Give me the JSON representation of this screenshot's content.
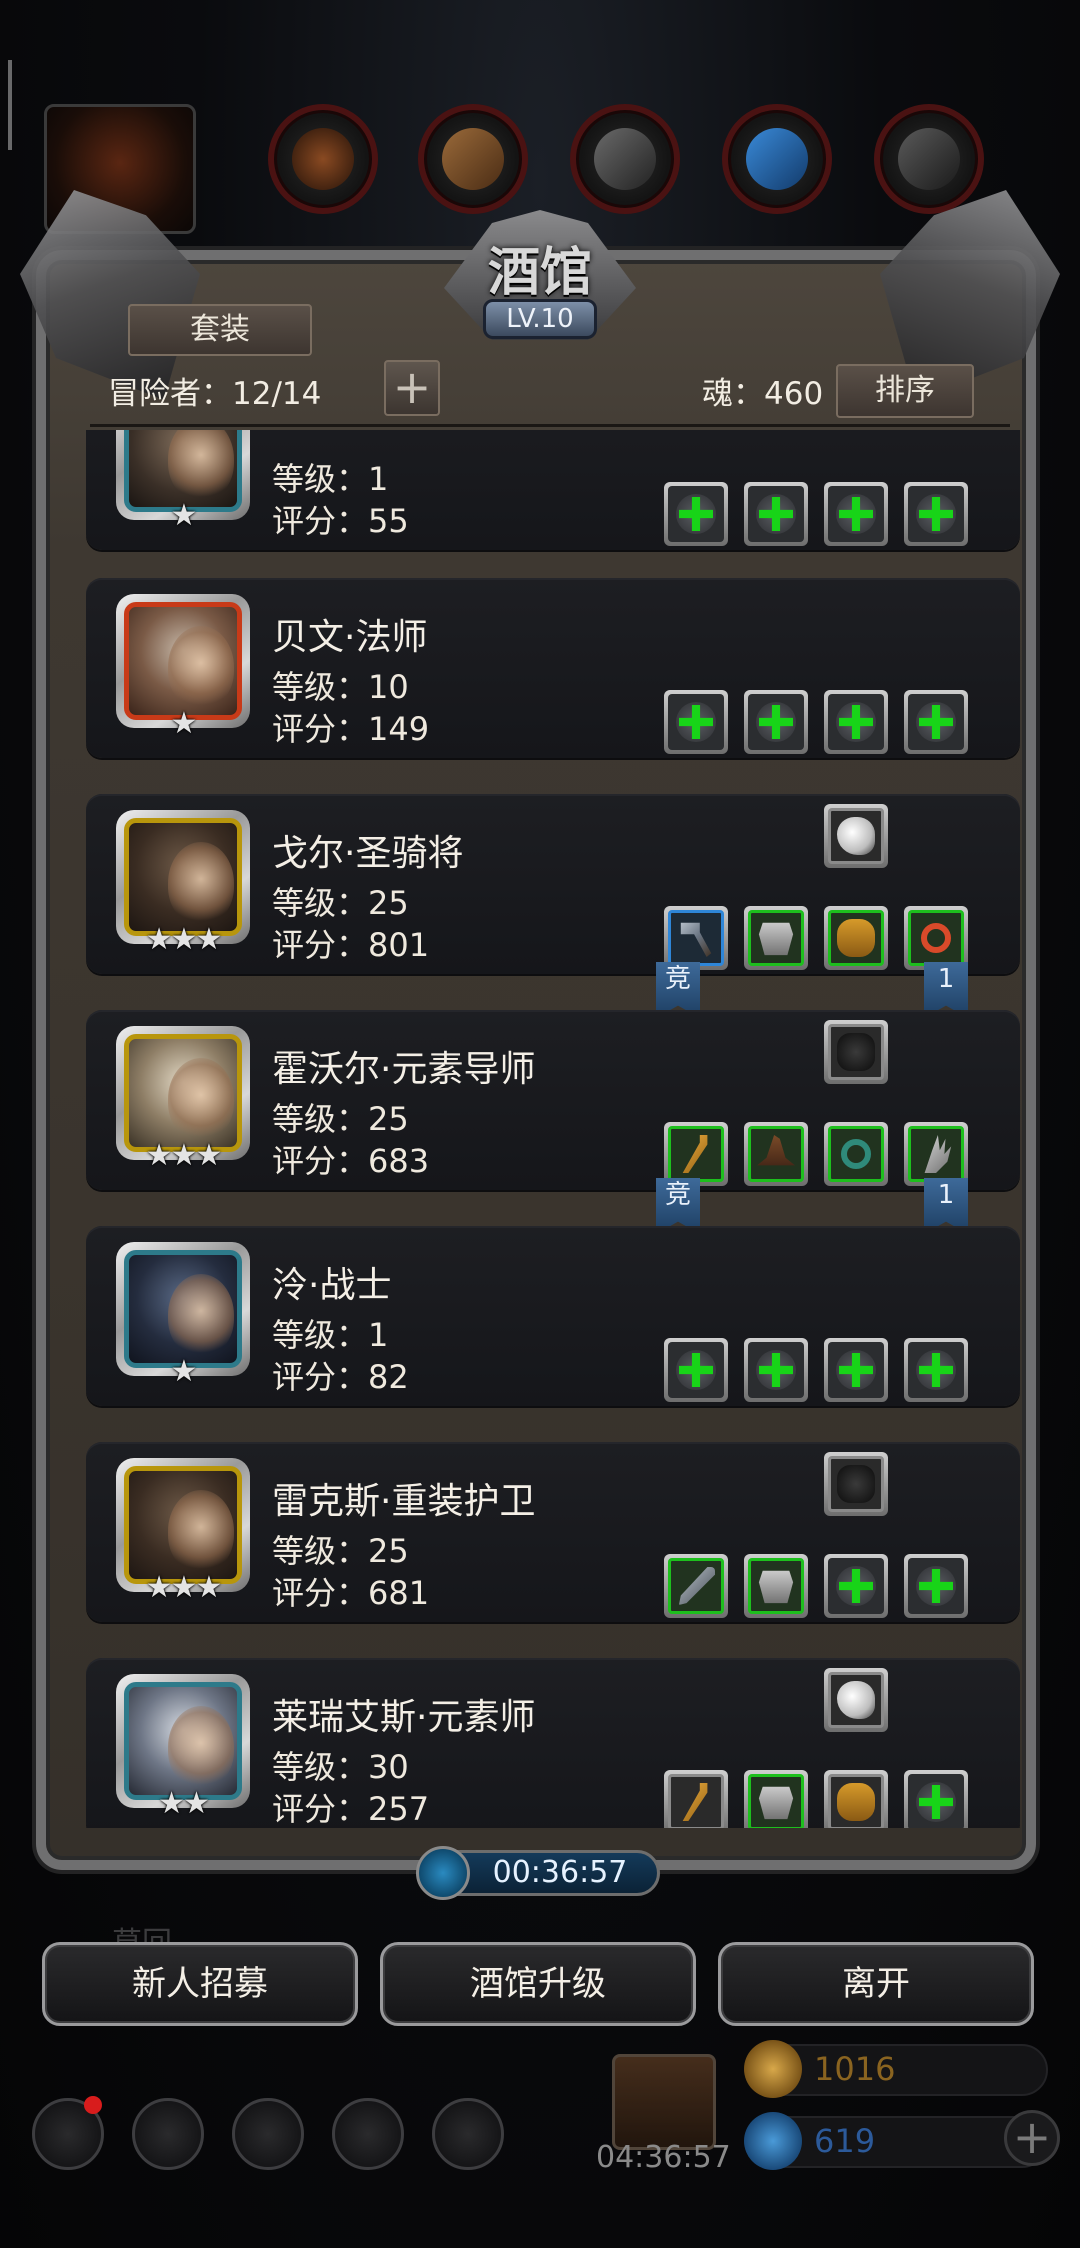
{
  "panel": {
    "title": "酒馆",
    "level": "LV.10",
    "suit_button": "套装",
    "adventurer_count": "冒险者：12/14",
    "add_icon": "+",
    "soul": "魂：460",
    "sort_button": "排序"
  },
  "heroes": [
    {
      "name": "",
      "level": "等级：1",
      "score": "评分：55",
      "stars": "★",
      "frame": "teal",
      "slots": [
        "empty",
        "empty",
        "empty",
        "empty"
      ]
    },
    {
      "name": "贝文·法师",
      "level": "等级：10",
      "score": "评分：149",
      "stars": "★",
      "frame": "red",
      "slots": [
        "empty",
        "empty",
        "empty",
        "empty"
      ]
    },
    {
      "name": "戈尔·圣骑将",
      "level": "等级：25",
      "score": "评分：801",
      "stars": "★★★",
      "frame": "gold",
      "slots": [
        "hammer",
        "armor",
        "barrel",
        "ring"
      ],
      "extra_slot": "feather",
      "ribbon_left": "竞",
      "ribbon_right": "1"
    },
    {
      "name": "霍沃尔·元素导师",
      "level": "等级：25",
      "score": "评分：683",
      "stars": "★★★",
      "frame": "gold",
      "slots": [
        "staff",
        "hat",
        "ring",
        "claw"
      ],
      "extra_slot": "glove",
      "ribbon_left": "竞",
      "ribbon_right": "1"
    },
    {
      "name": "泠·战士",
      "level": "等级：1",
      "score": "评分：82",
      "stars": "★",
      "frame": "teal",
      "slots": [
        "empty",
        "empty",
        "empty",
        "empty"
      ]
    },
    {
      "name": "雷克斯·重装护卫",
      "level": "等级：25",
      "score": "评分：681",
      "stars": "★★★",
      "frame": "gold",
      "slots": [
        "sword",
        "armor",
        "empty",
        "empty"
      ],
      "extra_slot": "glove"
    },
    {
      "name": "莱瑞艾斯·元素师",
      "level": "等级：30",
      "score": "评分：257",
      "stars": "★★",
      "frame": "teal",
      "slots": [
        "staff",
        "armor",
        "barrel",
        "empty"
      ],
      "extra_slot": "feather"
    }
  ],
  "timer": "00:36:57",
  "bottom_buttons": [
    "新人招募",
    "酒馆升级",
    "离开"
  ],
  "faded_label": "草回",
  "gift_timer": "04:36:57",
  "currency": {
    "gold": "1016",
    "gems": "619"
  },
  "colors": {
    "plus_green": "#18d418",
    "panel": "#3e3831",
    "ribbon": "#2d5a8a"
  },
  "icons": [
    "settings-icon",
    "achievement-icon",
    "guild-icon",
    "mail-icon",
    "dice-icon",
    "gift-icon",
    "gold-icon",
    "gem-icon"
  ]
}
